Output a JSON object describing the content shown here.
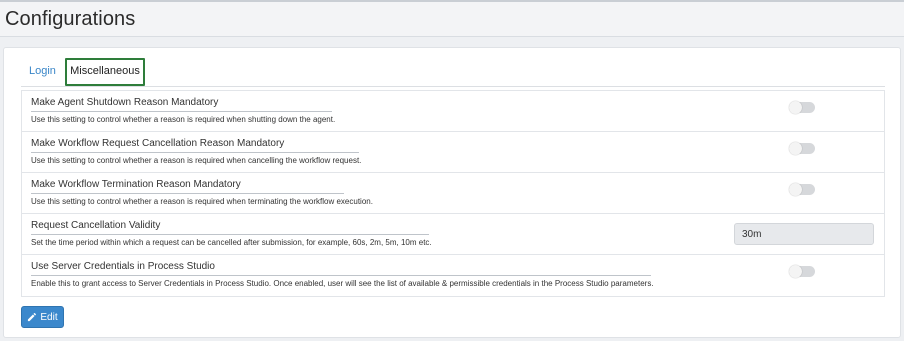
{
  "page": {
    "title": "Configurations"
  },
  "tabs": [
    {
      "label": "Login",
      "active": false
    },
    {
      "label": "Miscellaneous",
      "active": true
    }
  ],
  "settings": [
    {
      "title": "Make Agent Shutdown Reason Mandatory",
      "description": "Use this setting to control whether a reason is required when shutting down the agent.",
      "control": "toggle",
      "enabled": false
    },
    {
      "title": "Make Workflow Request Cancellation Reason Mandatory",
      "description": "Use this setting to control whether a reason is required when cancelling the workflow request.",
      "control": "toggle",
      "enabled": false
    },
    {
      "title": "Make Workflow Termination Reason Mandatory",
      "description": "Use this setting to control whether a reason is required when terminating the workflow execution.",
      "control": "toggle",
      "enabled": false
    },
    {
      "title": "Request Cancellation Validity",
      "description": "Set the time period within which a request can be cancelled after submission, for example, 60s, 2m, 5m, 10m etc.",
      "control": "text",
      "value": "30m"
    },
    {
      "title": "Use Server Credentials in Process Studio",
      "description": "Enable this to grant access to Server Credentials in Process Studio. Once enabled, user will see the list of available & permissible credentials in the Process Studio parameters.",
      "control": "toggle",
      "enabled": false
    }
  ],
  "actions": {
    "edit_label": "Edit",
    "edit_icon": "pencil-icon"
  },
  "colors": {
    "accent": "#3b88cc",
    "active_tab_border": "#2e7d3a",
    "toggle_off": "#d6d8db"
  }
}
